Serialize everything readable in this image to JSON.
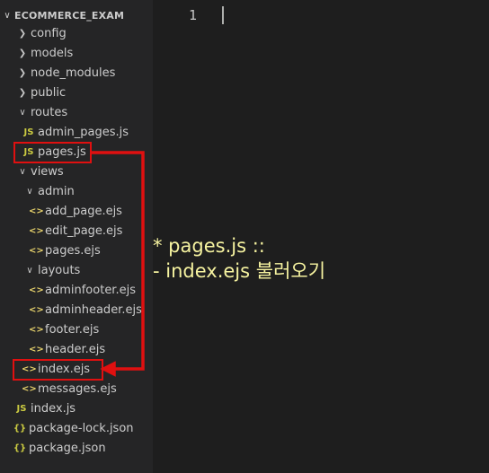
{
  "explorer": {
    "section_title": "ECOMMERCE_EXAM",
    "items": [
      {
        "label": "config",
        "type": "folder"
      },
      {
        "label": "models",
        "type": "folder"
      },
      {
        "label": "node_modules",
        "type": "folder"
      },
      {
        "label": "public",
        "type": "folder"
      },
      {
        "label": "routes",
        "type": "folder-open"
      },
      {
        "label": "admin_pages.js",
        "type": "js",
        "icon": "JS"
      },
      {
        "label": "pages.js",
        "type": "js",
        "icon": "JS"
      },
      {
        "label": "views",
        "type": "folder-open"
      },
      {
        "label": "admin",
        "type": "folder-open"
      },
      {
        "label": "add_page.ejs",
        "type": "ejs",
        "icon": "<>"
      },
      {
        "label": "edit_page.ejs",
        "type": "ejs",
        "icon": "<>"
      },
      {
        "label": "pages.ejs",
        "type": "ejs",
        "icon": "<>"
      },
      {
        "label": "layouts",
        "type": "folder-open"
      },
      {
        "label": "adminfooter.ejs",
        "type": "ejs",
        "icon": "<>"
      },
      {
        "label": "adminheader.ejs",
        "type": "ejs",
        "icon": "<>"
      },
      {
        "label": "footer.ejs",
        "type": "ejs",
        "icon": "<>"
      },
      {
        "label": "header.ejs",
        "type": "ejs",
        "icon": "<>"
      },
      {
        "label": "index.ejs",
        "type": "ejs",
        "icon": "<>"
      },
      {
        "label": "messages.ejs",
        "type": "ejs",
        "icon": "<>"
      },
      {
        "label": "index.js",
        "type": "js",
        "icon": "JS"
      },
      {
        "label": "package-lock.json",
        "type": "json",
        "icon": "{}"
      },
      {
        "label": "package.json",
        "type": "json",
        "icon": "{}"
      }
    ]
  },
  "editor": {
    "line_number": "1"
  },
  "annotation": {
    "line1": "* pages.js ::",
    "line2": "- index.ejs 불러오기"
  },
  "colors": {
    "highlight": "#e01010",
    "annotation_text": "#f6f3a0",
    "js_icon": "#cbcb41",
    "ejs_icon": "#e8d36c"
  }
}
